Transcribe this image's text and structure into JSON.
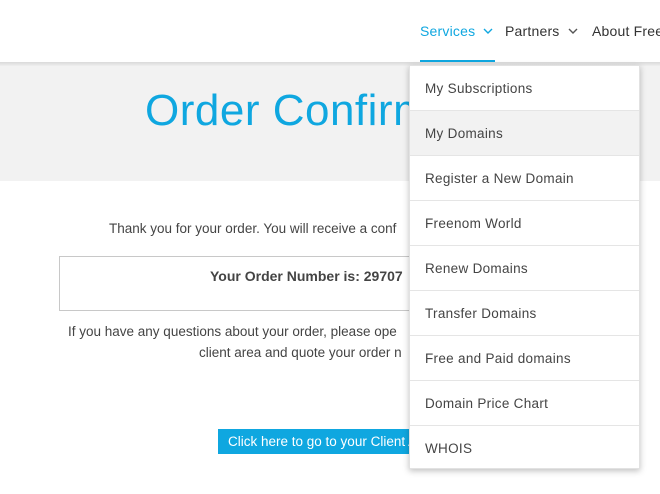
{
  "nav": {
    "items": [
      {
        "label": "Services",
        "active": true
      },
      {
        "label": "Partners",
        "active": false
      },
      {
        "label": "About Free",
        "active": false
      }
    ],
    "accent_color": "#0fa7e0"
  },
  "hero": {
    "title": "Order Confirm"
  },
  "main": {
    "thanks_text": "Thank you for your order. You will receive a conf",
    "order_number_text": "Your Order Number is: 29707",
    "questions_line1": "If you have any questions about your order, please ope",
    "questions_line2": "client area and quote your order n",
    "client_area_button": "Click here to go to your Client A"
  },
  "dropdown": {
    "items": [
      {
        "label": "My Subscriptions"
      },
      {
        "label": "My Domains",
        "hovered": true
      },
      {
        "label": "Register a New Domain"
      },
      {
        "label": "Freenom World"
      },
      {
        "label": "Renew Domains"
      },
      {
        "label": "Transfer Domains"
      },
      {
        "label": "Free and Paid domains"
      },
      {
        "label": "Domain Price Chart"
      },
      {
        "label": "WHOIS"
      }
    ]
  }
}
